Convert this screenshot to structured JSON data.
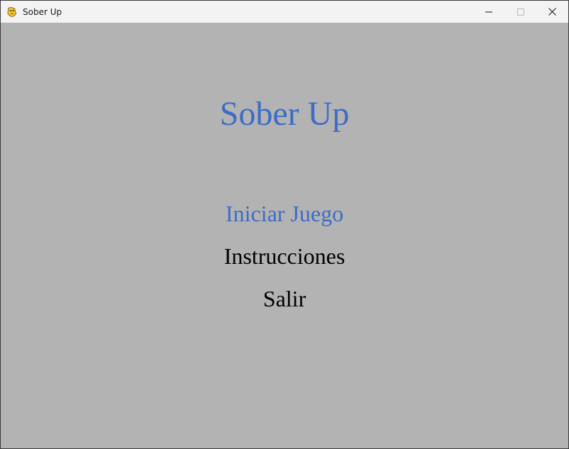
{
  "window": {
    "title": "Sober Up",
    "icon": "pygame-snake-icon"
  },
  "game": {
    "title": "Sober Up",
    "menu": [
      {
        "label": "Iniciar Juego",
        "selected": true
      },
      {
        "label": "Instrucciones",
        "selected": false
      },
      {
        "label": "Salir",
        "selected": false
      }
    ]
  },
  "colors": {
    "background": "#b3b3b3",
    "accent": "#3d6cc7",
    "text": "#000000",
    "titlebar": "#f3f3f3"
  }
}
